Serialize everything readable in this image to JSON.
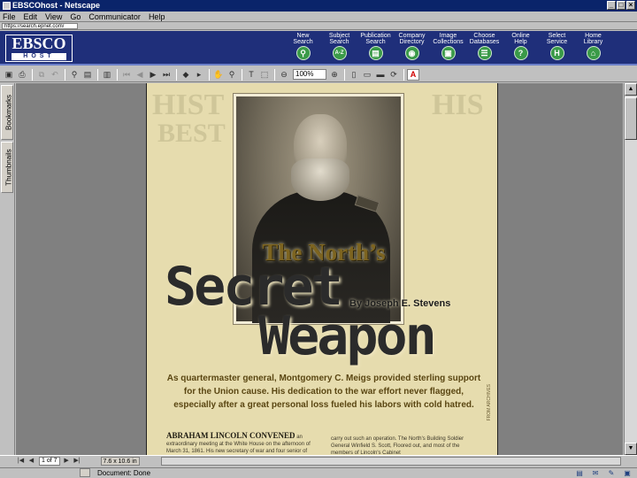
{
  "window": {
    "title": "EBSCOhost - Netscape"
  },
  "menu": [
    "File",
    "Edit",
    "View",
    "Go",
    "Communicator",
    "Help"
  ],
  "url": {
    "value": "https://search.epnet.com/"
  },
  "ebsco": {
    "logo_top": "EBSCO",
    "logo_bottom": "HOST",
    "nav": [
      {
        "label": "New\nSearch",
        "icon": "magnifier-icon",
        "glyph": "⚲"
      },
      {
        "label": "Subject\nSearch",
        "icon": "az-icon",
        "glyph": "A-Z"
      },
      {
        "label": "Publication\nSearch",
        "icon": "book-icon",
        "glyph": "▤"
      },
      {
        "label": "Company\nDirectory",
        "icon": "directory-icon",
        "glyph": "◉"
      },
      {
        "label": "Image\nCollections",
        "icon": "image-icon",
        "glyph": "▣"
      },
      {
        "label": "Choose\nDatabases",
        "icon": "database-icon",
        "glyph": "☰"
      },
      {
        "label": "Online\nHelp",
        "icon": "help-icon",
        "glyph": "?"
      },
      {
        "label": "Select\nService",
        "icon": "service-icon",
        "glyph": "H"
      },
      {
        "label": "Home\nLibrary",
        "icon": "library-icon",
        "glyph": "⌂"
      }
    ]
  },
  "toolbar": {
    "zoom": "100%"
  },
  "lefttabs": {
    "bookmarks": "Bookmarks",
    "thumbnails": "Thumbnails"
  },
  "article": {
    "ghost_left": "HIST",
    "ghost_right": "HIS",
    "ghost_left2": "BEST",
    "title_1": "The North’s",
    "title_2": "Secret",
    "title_3": "Weapon",
    "byline": "By Joseph E. Stevens",
    "deck": "As quartermaster general, Montgomery C. Meigs provided sterling support for the Union cause. His dedication to the war effort never flagged, especially after a great personal loss fueled his labors with cold hatred.",
    "lead": "ABRAHAM LINCOLN CONVENED",
    "body_left": "an extraordinary meeting at the White House on the afternoon of March 31, 1861. His new secretary of war and four senior of",
    "body_right": "carry out such an operation. The North's Building Soldier General Winfield S. Scott, Floored out, and most of the members of Lincoln's Cabinet",
    "credit": "FROM ARCHIVES"
  },
  "bottombar": {
    "page": "1 of 7",
    "size": "7.6 x 10.6 in"
  },
  "status": {
    "text": "Document: Done"
  },
  "colors": {
    "ebsco_bg": "#1f2f7a",
    "nav_icon": "#3a9a48",
    "title_bar": "#0a246a",
    "page_bg": "#e6dcae"
  }
}
